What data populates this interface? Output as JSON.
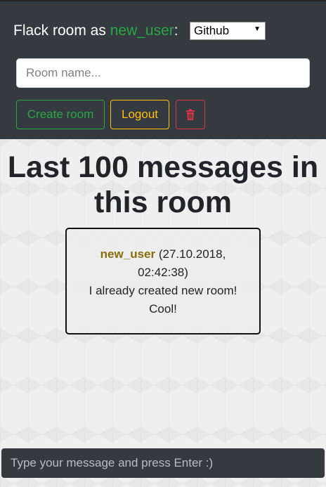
{
  "header": {
    "title_prefix": "Flack room as",
    "username": "new_user",
    "title_suffix": ":",
    "auth_select": {
      "selected": "Github"
    }
  },
  "room_form": {
    "placeholder": "Room name...",
    "create_label": "Create room",
    "logout_label": "Logout",
    "delete_icon": "trash-icon"
  },
  "main": {
    "heading": "Last 100 messages in this room",
    "messages": [
      {
        "author": "new_user",
        "timestamp": "(27.10.2018, 02:42:38)",
        "text": "I already created new room! Cool!"
      }
    ]
  },
  "composer": {
    "placeholder": "Type your message and press Enter :)"
  },
  "colors": {
    "topbar": "#343a40",
    "success": "#28a745",
    "warning": "#ffc107",
    "danger": "#dc3545",
    "author": "#8a6d0b"
  }
}
